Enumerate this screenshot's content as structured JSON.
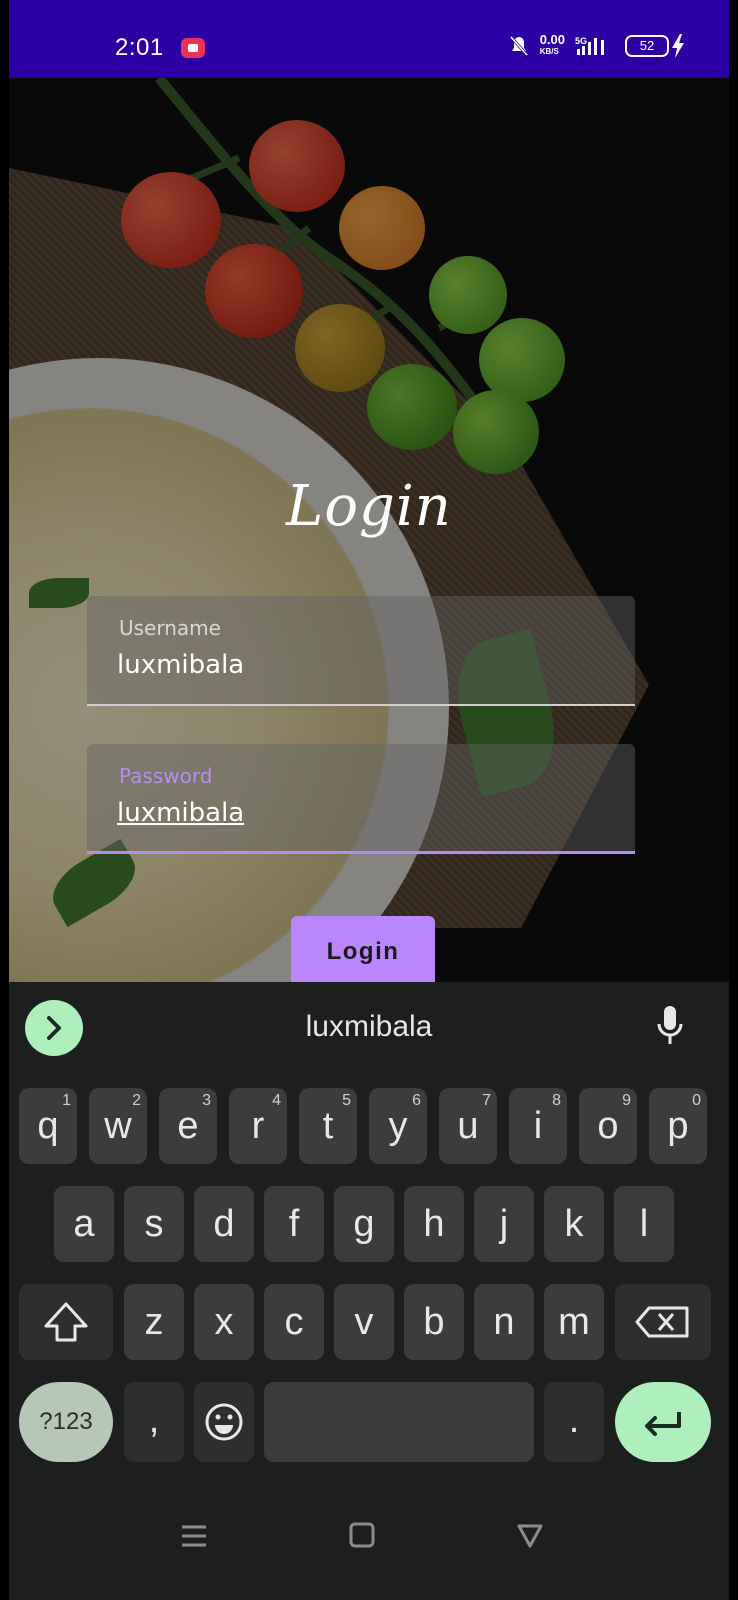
{
  "status_bar": {
    "time": "2:01",
    "net_speed": "0.00",
    "net_unit": "KB/S",
    "signal": "5G",
    "battery": "52"
  },
  "screen": {
    "title": "Login",
    "username": {
      "label": "Username",
      "value": "luxmibala"
    },
    "password": {
      "label": "Password",
      "value": "luxmibala"
    },
    "login_button": "Login"
  },
  "keyboard": {
    "suggestion": "luxmibala",
    "row1": [
      {
        "key": "q",
        "sup": "1"
      },
      {
        "key": "w",
        "sup": "2"
      },
      {
        "key": "e",
        "sup": "3"
      },
      {
        "key": "r",
        "sup": "4"
      },
      {
        "key": "t",
        "sup": "5"
      },
      {
        "key": "y",
        "sup": "6"
      },
      {
        "key": "u",
        "sup": "7"
      },
      {
        "key": "i",
        "sup": "8"
      },
      {
        "key": "o",
        "sup": "9"
      },
      {
        "key": "p",
        "sup": "0"
      }
    ],
    "row2": [
      "a",
      "s",
      "d",
      "f",
      "g",
      "h",
      "j",
      "k",
      "l"
    ],
    "row3": [
      "z",
      "x",
      "c",
      "v",
      "b",
      "n",
      "m"
    ],
    "symbols_key": "?123",
    "comma_key": ",",
    "period_key": "."
  },
  "colors": {
    "status_bar": "#2d00a6",
    "accent": "#bb86fc",
    "keyboard_accent": "#aef0bc"
  }
}
